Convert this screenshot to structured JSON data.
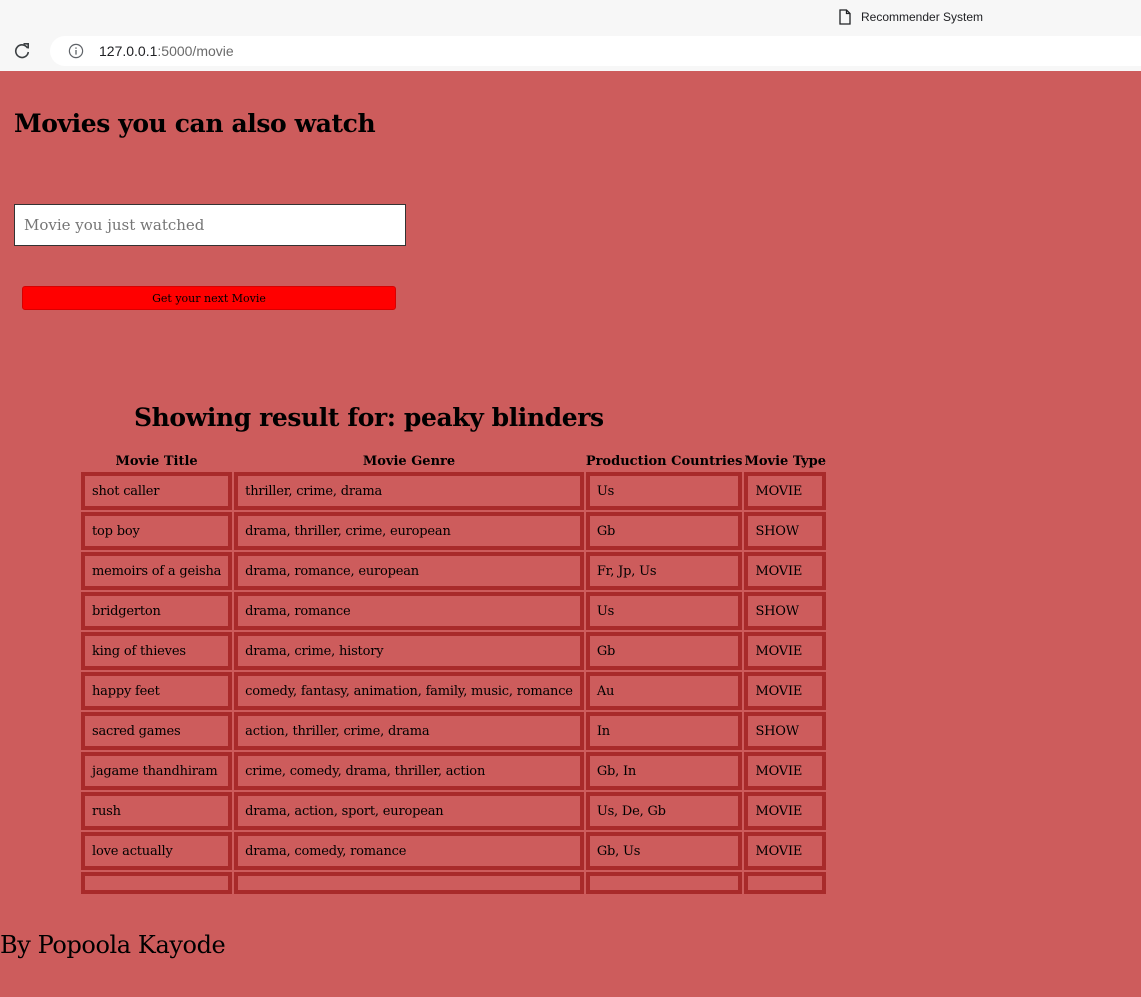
{
  "browser": {
    "tab_title": "Recommender System",
    "url_host": "127.0.0.1",
    "url_rest": ":5000/movie",
    "icons": [
      "page-icon",
      "reload-icon",
      "info-icon"
    ]
  },
  "page": {
    "heading": "Movies you can also watch",
    "search": {
      "placeholder": "Movie you just watched",
      "value": ""
    },
    "submit_label": "Get your next Movie",
    "result_heading": "Showing result for: peaky blinders",
    "table": {
      "headers": [
        "Movie Title",
        "Movie Genre",
        "Production Countries",
        "Movie Type"
      ],
      "rows": [
        [
          "shot caller",
          "thriller, crime, drama",
          "Us",
          "MOVIE"
        ],
        [
          "top boy",
          "drama, thriller, crime, european",
          "Gb",
          "SHOW"
        ],
        [
          "memoirs of a geisha",
          "drama, romance, european",
          "Fr, Jp, Us",
          "MOVIE"
        ],
        [
          "bridgerton",
          "drama, romance",
          "Us",
          "SHOW"
        ],
        [
          "king of thieves",
          "drama, crime, history",
          "Gb",
          "MOVIE"
        ],
        [
          "happy feet",
          "comedy, fantasy, animation, family, music, romance",
          "Au",
          "MOVIE"
        ],
        [
          "sacred games",
          "action, thriller, crime, drama",
          "In",
          "SHOW"
        ],
        [
          "jagame thandhiram",
          "crime, comedy, drama, thriller, action",
          "Gb, In",
          "MOVIE"
        ],
        [
          "rush",
          "drama, action, sport, european",
          "Us, De, Gb",
          "MOVIE"
        ],
        [
          "love actually",
          "drama, comedy, romance",
          "Gb, Us",
          "MOVIE"
        ],
        [
          "",
          "",
          "",
          ""
        ]
      ]
    },
    "footer": "By Popoola Kayode"
  },
  "colors": {
    "page_background": "#cd5c5c",
    "button_background": "#ff0000",
    "cell_border": "#a82a2a"
  }
}
